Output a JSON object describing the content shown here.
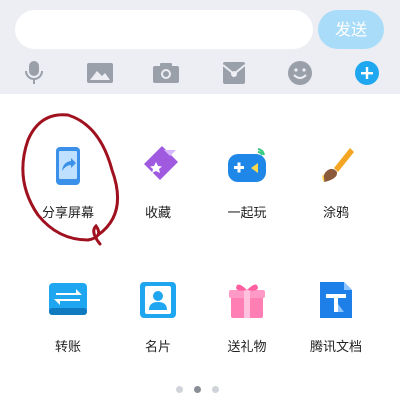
{
  "input_bar": {
    "message_value": "",
    "message_placeholder": "",
    "send_label": "发送"
  },
  "toolbar": {
    "items": [
      {
        "icon": "microphone-icon"
      },
      {
        "icon": "image-icon"
      },
      {
        "icon": "camera-icon"
      },
      {
        "icon": "red-packet-icon"
      },
      {
        "icon": "emoji-icon"
      },
      {
        "icon": "plus-icon"
      }
    ]
  },
  "grid": {
    "items": [
      {
        "label": "分享屏幕",
        "icon": "screen-share-icon"
      },
      {
        "label": "收藏",
        "icon": "favorite-icon"
      },
      {
        "label": "一起玩",
        "icon": "gamepad-icon"
      },
      {
        "label": "涂鸦",
        "icon": "paintbrush-icon"
      },
      {
        "label": "转账",
        "icon": "transfer-icon"
      },
      {
        "label": "名片",
        "icon": "contact-card-icon"
      },
      {
        "label": "送礼物",
        "icon": "gift-icon"
      },
      {
        "label": "腾讯文档",
        "icon": "tencent-docs-icon"
      }
    ]
  },
  "pagination": {
    "pages": 3,
    "current": 2
  },
  "colors": {
    "accent": "#1fa8f0",
    "send_disabled": "#a9dcf8",
    "annotation": "#a0111f",
    "toolbar_icon": "#9aa0aa"
  }
}
